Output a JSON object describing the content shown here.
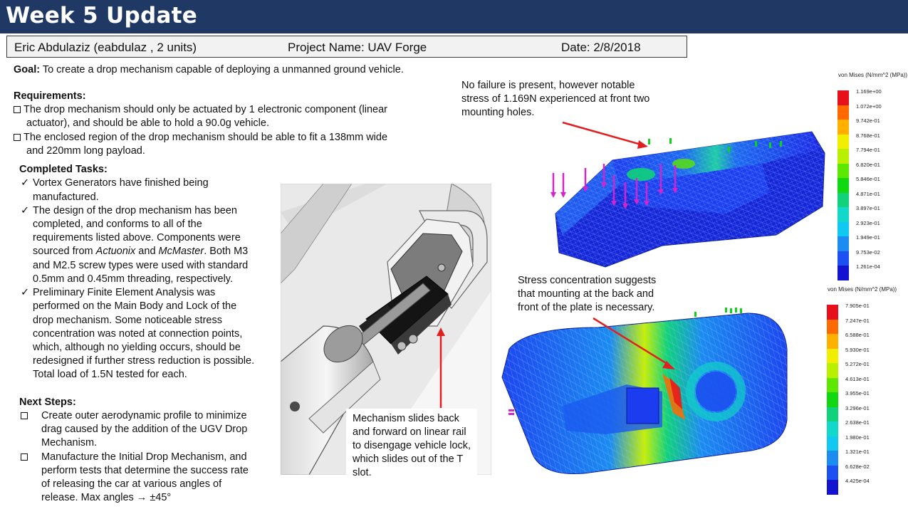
{
  "header": {
    "title": "Week 5 Update"
  },
  "info": {
    "author": "Eric Abdulaziz (eabdulaz , 2 units)",
    "project": "Project Name: UAV Forge",
    "date": "Date: 2/8/2018"
  },
  "goal": {
    "label": "Goal:",
    "text": " To create a drop mechanism capable of deploying a unmanned ground vehicle."
  },
  "requirements": {
    "heading": "Requirements:",
    "items": [
      [
        "The drop mechanism should only be actuated by 1 electronic component (linear",
        "actuator), and should be able to hold a 90.0g vehicle."
      ],
      [
        "The enclosed region of the drop mechanism should be able to fit a 138mm wide",
        "and 220mm long payload."
      ]
    ]
  },
  "completed": {
    "heading": "Completed Tasks:",
    "item1": [
      "Vortex Generators have finished being",
      "manufactured."
    ],
    "item2": [
      "The design of the drop mechanism has been",
      "completed, and conforms to all of the",
      "requirements listed above. Components were"
    ],
    "item2_src_pre": "sourced from ",
    "item2_src_a": "Actuonix",
    "item2_src_mid": " and ",
    "item2_src_b": "McMaster",
    "item2_src_post": ". Both M3",
    "item2_tail": [
      "and M2.5 screw types were used with standard",
      "0.5mm and 0.45mm threading, respectively."
    ],
    "item3": [
      "Preliminary Finite Element Analysis was",
      "performed on the Main Body and Lock of the",
      "drop mechanism. Some noticeable stress",
      "concentration was noted at connection points,",
      "which, although no yielding occurs, should be",
      "redesigned if further stress reduction is possible.",
      "Total load of 1.5N tested for each."
    ]
  },
  "next_steps": {
    "heading": "Next Steps:",
    "item1": [
      "Create outer aerodynamic profile to minimize",
      "drag caused by the addition of the UGV Drop",
      "Mechanism."
    ],
    "item2": [
      "Manufacture the Initial Drop Mechanism, and",
      "perform tests that determine the success rate",
      "of releasing the car at various angles of",
      "release. Max angles → ±45°"
    ]
  },
  "callouts": {
    "mechanism": [
      "Mechanism slides back",
      "and forward on linear rail",
      "to disengage vehicle lock,",
      "which slides out of the T",
      "slot."
    ],
    "top_fea": [
      "No failure is present, however notable",
      "stress of 1.169N experienced at front two",
      "mounting holes."
    ],
    "bottom_fea": [
      "Stress concentration suggests",
      "that mounting at the back and",
      "front of the plate is necessary."
    ]
  },
  "legend_top": {
    "title": "von Mises (N/mm^2 (MPa))",
    "values": [
      "1.169e+00",
      "1.072e+00",
      "9.742e-01",
      "8.768e-01",
      "7.794e-01",
      "6.820e-01",
      "5.846e-01",
      "4.871e-01",
      "3.897e-01",
      "2.923e-01",
      "1.949e-01",
      "9.753e-02",
      "1.261e-04"
    ]
  },
  "legend_bottom": {
    "title": "von Mises (N/mm^2 (MPa))",
    "values": [
      "7.905e-01",
      "7.247e-01",
      "6.588e-01",
      "5.930e-01",
      "5.272e-01",
      "4.613e-01",
      "3.955e-01",
      "3.296e-01",
      "2.638e-01",
      "1.980e-01",
      "1.321e-01",
      "6.628e-02",
      "4.425e-04"
    ]
  },
  "colors": {
    "title_bar": "#1f3864",
    "arrow": "#e02020",
    "legend": [
      "#e8101a",
      "#ff6a00",
      "#ffb000",
      "#f2ee00",
      "#b8f000",
      "#5ce800",
      "#12d812",
      "#10d27a",
      "#12d8cc",
      "#10c8f0",
      "#1c8cf0",
      "#1c50f0",
      "#1414d0"
    ]
  }
}
